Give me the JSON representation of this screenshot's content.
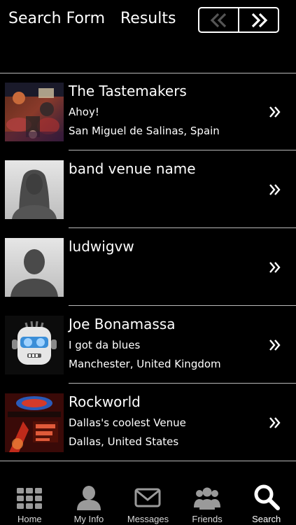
{
  "header": {
    "tab_search_form": "Search Form",
    "tab_results": "Results",
    "pager_prev_icon": "double-chevron-left-icon",
    "pager_next_icon": "double-chevron-right-icon"
  },
  "results": [
    {
      "name": "The Tastemakers",
      "line1": "Ahoy!",
      "line2": "San Miguel de Salinas, Spain",
      "thumb": "band-photo"
    },
    {
      "name": "band venue name",
      "line1": "",
      "line2": "",
      "thumb": "default-avatar-female"
    },
    {
      "name": "ludwigvw",
      "line1": "",
      "line2": "",
      "thumb": "default-avatar-male"
    },
    {
      "name": "Joe Bonamassa",
      "line1": "I got da blues",
      "line2": "Manchester, United Kingdom",
      "thumb": "robot-avatar"
    },
    {
      "name": "Rockworld",
      "line1": "Dallas's coolest Venue",
      "line2": "Dallas, United States",
      "thumb": "rock-poster"
    }
  ],
  "tabbar": [
    {
      "label": "Home",
      "icon": "grid-icon"
    },
    {
      "label": "My Info",
      "icon": "person-icon"
    },
    {
      "label": "Messages",
      "icon": "envelope-icon"
    },
    {
      "label": "Friends",
      "icon": "group-icon"
    },
    {
      "label": "Search",
      "icon": "search-icon",
      "active": true
    }
  ],
  "colors": {
    "background": "#000000",
    "text": "#ffffff",
    "divider": "#b8b8b8",
    "tab_icon": "#9a9a9a",
    "tab_icon_active": "#ffffff"
  }
}
